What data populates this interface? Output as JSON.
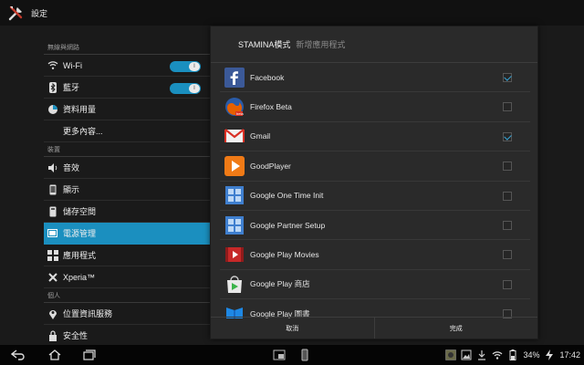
{
  "titlebar": {
    "title": "設定",
    "icon": "settings-tools-icon"
  },
  "settings": {
    "sections": [
      {
        "header": "無線與網路",
        "items": [
          {
            "label": "Wi-Fi",
            "icon": "wifi-icon",
            "toggle": "I"
          },
          {
            "label": "藍牙",
            "icon": "bluetooth-icon",
            "toggle": "I"
          },
          {
            "label": "資料用量",
            "icon": "data-usage-icon"
          },
          {
            "label": "更多內容...",
            "icon": ""
          }
        ]
      },
      {
        "header": "裝置",
        "items": [
          {
            "label": "音效",
            "icon": "sound-icon"
          },
          {
            "label": "顯示",
            "icon": "display-icon"
          },
          {
            "label": "儲存空間",
            "icon": "storage-icon"
          },
          {
            "label": "電源管理",
            "icon": "battery-icon",
            "selected": true
          },
          {
            "label": "應用程式",
            "icon": "apps-icon"
          },
          {
            "label": "Xperia™",
            "icon": "xperia-icon"
          }
        ]
      },
      {
        "header": "個人",
        "items": [
          {
            "label": "位置資訊服務",
            "icon": "location-icon"
          },
          {
            "label": "安全性",
            "icon": "lock-icon"
          }
        ]
      }
    ]
  },
  "dialog": {
    "title": "STAMINA模式",
    "subtitle": "新增應用程式",
    "apps": [
      {
        "name": "Facebook",
        "icon": "facebook-icon",
        "checked": true
      },
      {
        "name": "Firefox Beta",
        "icon": "firefox-icon",
        "checked": false
      },
      {
        "name": "Gmail",
        "icon": "gmail-icon",
        "checked": true
      },
      {
        "name": "GoodPlayer",
        "icon": "goodplayer-icon",
        "checked": false
      },
      {
        "name": "Google One Time Init",
        "icon": "android-app-icon",
        "checked": false
      },
      {
        "name": "Google Partner Setup",
        "icon": "android-app-icon",
        "checked": false
      },
      {
        "name": "Google Play Movies",
        "icon": "play-movies-icon",
        "checked": false
      },
      {
        "name": "Google Play 商店",
        "icon": "play-store-icon",
        "checked": false
      },
      {
        "name": "Google Play 圖書",
        "icon": "play-books-icon",
        "checked": false
      }
    ],
    "cancel_label": "取消",
    "done_label": "完成"
  },
  "statusbar": {
    "battery_percent": "34%",
    "time": "17:42"
  },
  "colors": {
    "accent": "#1b8fbf",
    "check": "#37a5d6"
  }
}
